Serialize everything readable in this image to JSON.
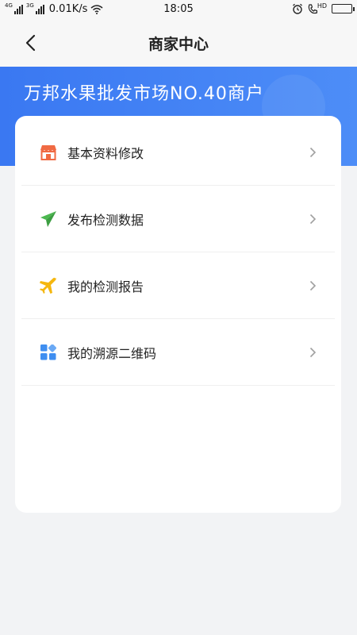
{
  "status_bar": {
    "net1": "4G",
    "net2": "3G",
    "speed": "0.01K/s",
    "time": "18:05",
    "hd": "HD"
  },
  "nav": {
    "title": "商家中心",
    "back_icon": "chevron-left-icon"
  },
  "banner": {
    "title": "万邦水果批发市场NO.40商户",
    "color": "#3a78f2"
  },
  "menu": [
    {
      "label": "基本资料修改",
      "icon": "store-icon",
      "color": "#f06a43"
    },
    {
      "label": "发布检测数据",
      "icon": "paper-plane-icon",
      "color": "#4bb84f"
    },
    {
      "label": "我的检测报告",
      "icon": "airplane-icon",
      "color": "#f5b70f"
    },
    {
      "label": "我的溯源二维码",
      "icon": "grid-icon",
      "color": "#3f8ef0"
    }
  ]
}
